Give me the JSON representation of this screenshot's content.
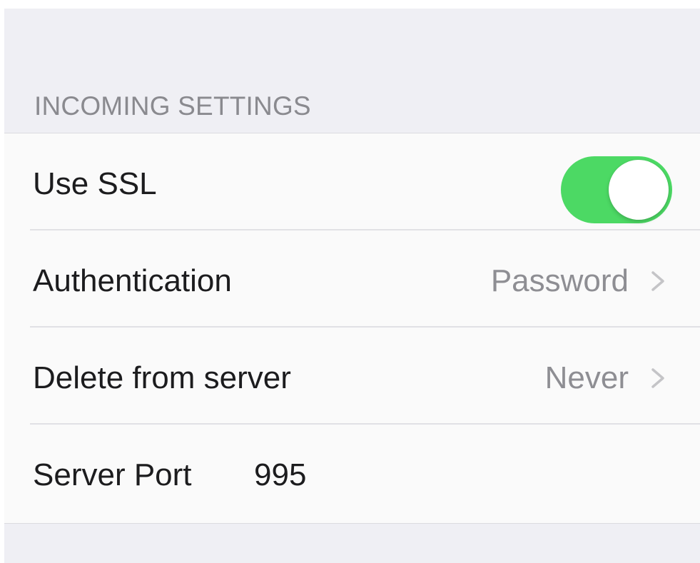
{
  "section": {
    "header": "INCOMING SETTINGS"
  },
  "rows": {
    "use_ssl": {
      "label": "Use SSL",
      "enabled": true
    },
    "authentication": {
      "label": "Authentication",
      "value": "Password"
    },
    "delete_from_server": {
      "label": "Delete from server",
      "value": "Never"
    },
    "server_port": {
      "label": "Server Port",
      "value": "995"
    }
  },
  "colors": {
    "toggle_on": "#4cd964",
    "background": "#efeff4",
    "detail_text": "#8e8e93",
    "header_text": "#8a8a8f"
  },
  "icons": {
    "disclosure": "chevron-right-icon"
  }
}
